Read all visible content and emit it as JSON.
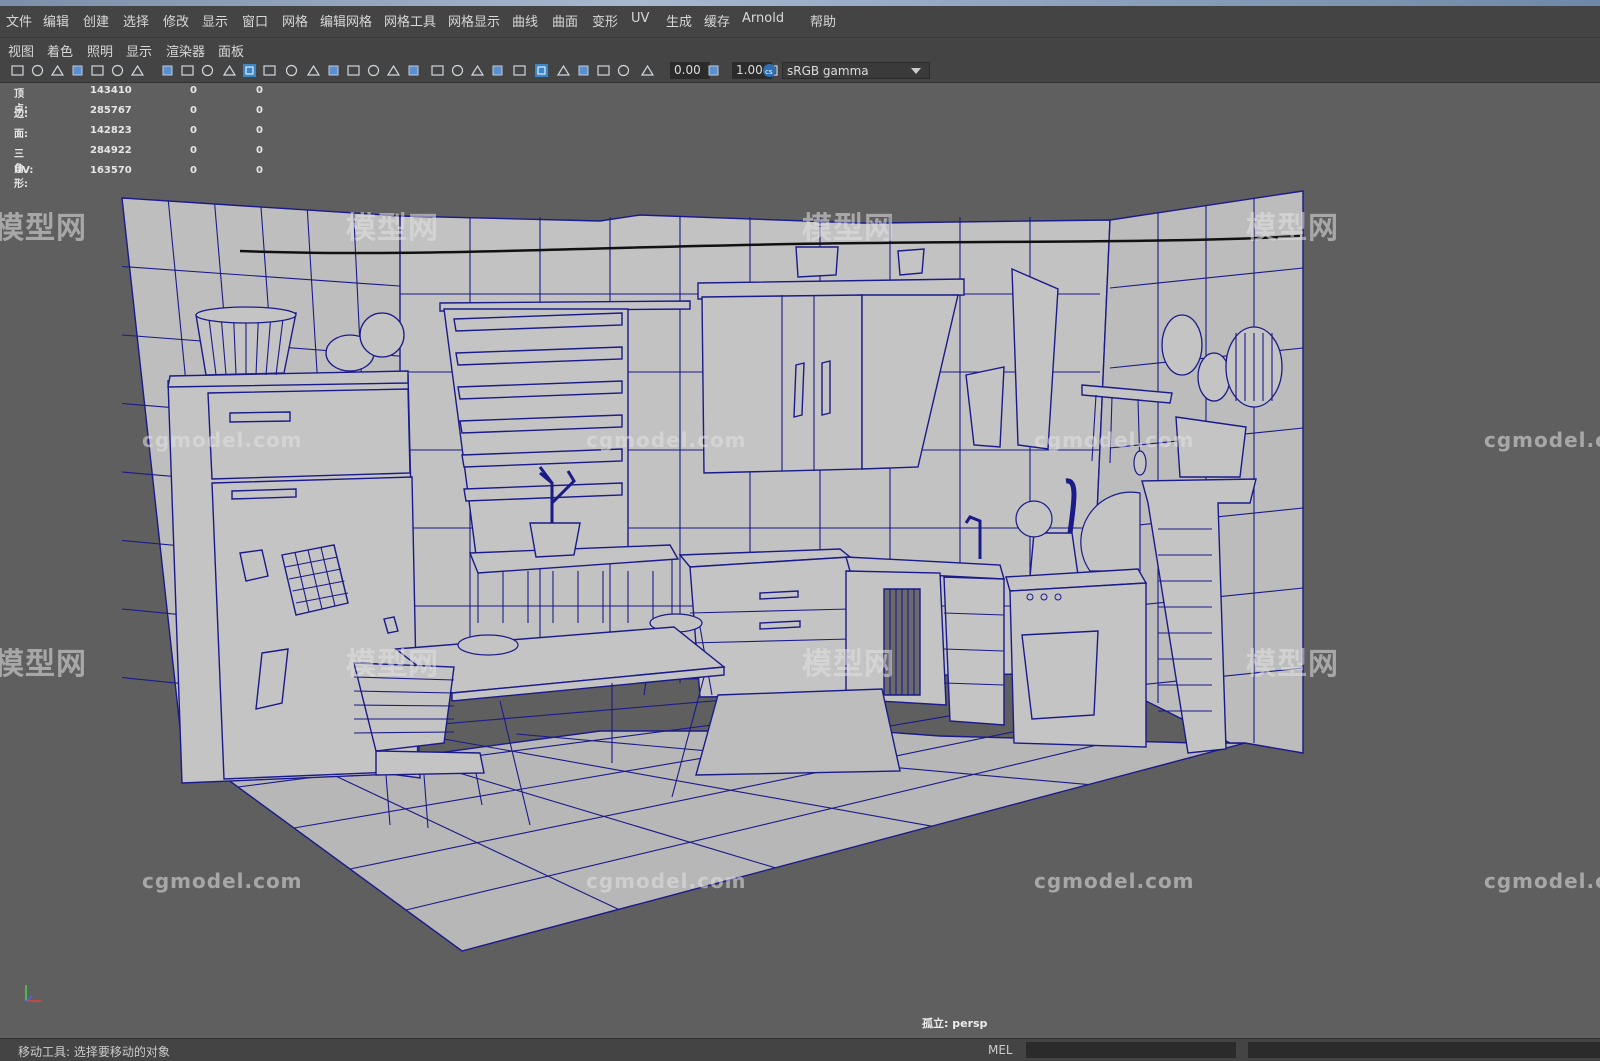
{
  "menu": [
    {
      "label": "文件"
    },
    {
      "label": "编辑"
    },
    {
      "label": "创建"
    },
    {
      "label": "选择"
    },
    {
      "label": "修改"
    },
    {
      "label": "显示"
    },
    {
      "label": "窗口"
    },
    {
      "label": "网格"
    },
    {
      "label": "编辑网格"
    },
    {
      "label": "网格工具"
    },
    {
      "label": "网格显示"
    },
    {
      "label": "曲线"
    },
    {
      "label": "曲面"
    },
    {
      "label": "变形"
    },
    {
      "label": "UV"
    },
    {
      "label": "生成"
    },
    {
      "label": "缓存"
    },
    {
      "label": "Arnold"
    },
    {
      "label": "帮助"
    }
  ],
  "view_menu": [
    {
      "label": "视图"
    },
    {
      "label": "着色"
    },
    {
      "label": "照明"
    },
    {
      "label": "显示"
    },
    {
      "label": "渲染器"
    },
    {
      "label": "面板"
    }
  ],
  "toolbar": {
    "exposure_value": "0.00",
    "gamma_value": "1.00",
    "colorspace": "sRGB gamma",
    "icons": [
      "camera-icon",
      "bookmark-icon",
      "grid-icon",
      "film-gate-icon",
      "resolution-gate-icon",
      "wireframe-icon",
      "smooth-shade-icon",
      "textured-icon",
      "lights-icon",
      "shadows-icon",
      "isolate-select-icon",
      "xray-icon",
      "exposure-icon",
      "gamma-icon",
      "colorspace-icon"
    ]
  },
  "hud": {
    "rows": [
      {
        "label": "顶点:",
        "v1": "143410",
        "v2": "0",
        "v3": "0"
      },
      {
        "label": "边:",
        "v1": "285767",
        "v2": "0",
        "v3": "0"
      },
      {
        "label": "面:",
        "v1": "142823",
        "v2": "0",
        "v3": "0"
      },
      {
        "label": "三角形:",
        "v1": "284922",
        "v2": "0",
        "v3": "0"
      },
      {
        "label": "UV:",
        "v1": "163570",
        "v2": "0",
        "v3": "0"
      }
    ]
  },
  "watermarks": {
    "url": "cgmodel.com",
    "cn": "模型网"
  },
  "camera_label": "孤立: persp",
  "status": {
    "help_text": "移动工具: 选择要移动的对象",
    "mel_label": "MEL"
  },
  "colors": {
    "wire": "#1a1a8a",
    "surface": "#c4c4c4",
    "viewport_bg": "#5f5f5f",
    "panel": "#444444"
  }
}
